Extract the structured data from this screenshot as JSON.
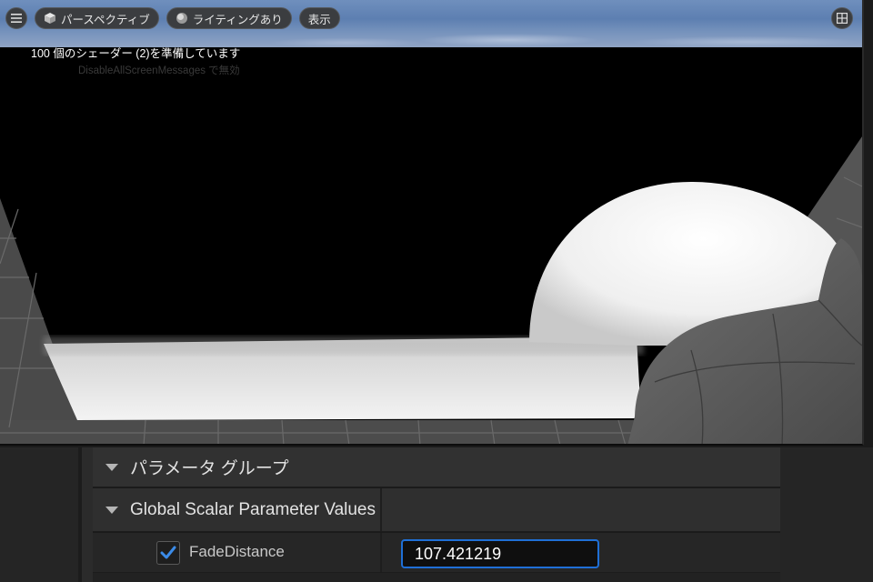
{
  "viewport": {
    "toolbar": {
      "menu_icon": "hamburger-menu-icon",
      "perspective_label": "パースペクティブ",
      "perspective_icon": "cube-icon",
      "lighting_label": "ライティングあり",
      "lighting_icon": "sphere-icon",
      "show_label": "表示",
      "layout_icon": "viewport-layout-icon"
    },
    "status_message": "100 個のシェーダー (2)を準備しています",
    "sub_message": "DisableAllScreenMessages で無効"
  },
  "details": {
    "category_parameter_groups": "パラメータ グループ",
    "category_global_scalar": "Global Scalar Parameter Values",
    "parameter": {
      "name": "FadeDistance",
      "enabled": true,
      "value": "107.421219"
    }
  },
  "colors": {
    "accent": "#1f6fd6",
    "checkbox_check": "#3b8be8"
  }
}
